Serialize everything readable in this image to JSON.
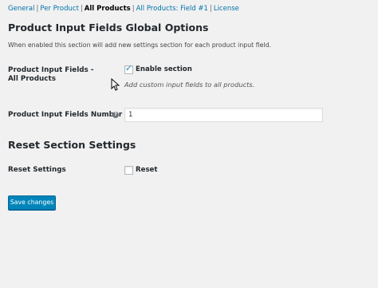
{
  "subnav": {
    "general": "General",
    "per_product": "Per Product",
    "all_products": "All Products",
    "all_products_field1": "All Products: Field #1",
    "license": "License",
    "separator": "|"
  },
  "section_global": {
    "title": "Product Input Fields Global Options",
    "description": "When enabled this section will add new settings section for each product input field.",
    "all_products_label": "Product Input Fields - All Products",
    "enable_label": "Enable section",
    "enable_checked": true,
    "enable_hint": "Add custom input fields to all products.",
    "number_label": "Product Input Fields Number",
    "number_value": "1"
  },
  "section_reset": {
    "title": "Reset Section Settings",
    "reset_label": "Reset Settings",
    "reset_checkbox_label": "Reset",
    "reset_checked": false
  },
  "save_button": "Save changes",
  "icons": {
    "help": "help-icon",
    "cursor": "mouse-cursor-icon"
  },
  "colors": {
    "link": "#0073aa",
    "primary_button": "#0085ba",
    "checkmark": "#1e8cbe"
  }
}
